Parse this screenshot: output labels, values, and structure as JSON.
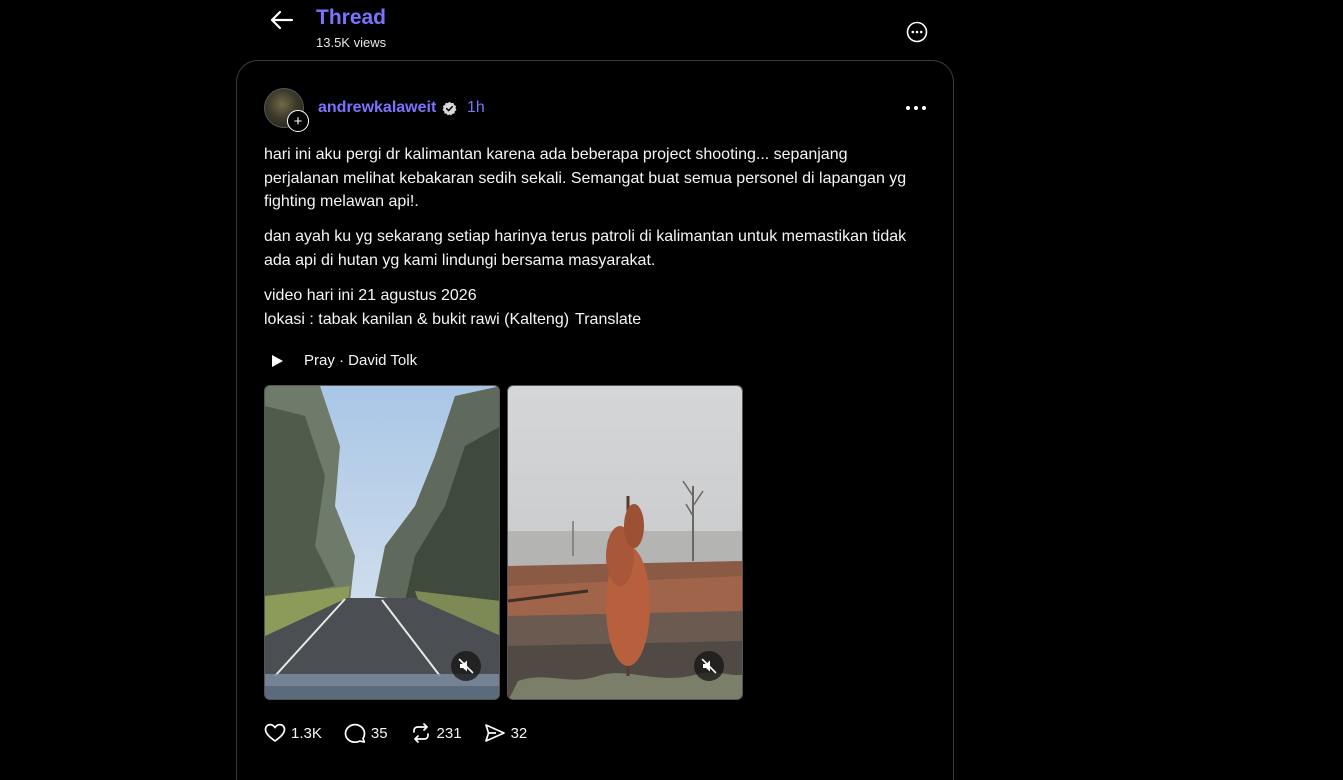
{
  "header": {
    "title": "Thread",
    "views": "13.5K views"
  },
  "post": {
    "username": "andrewkalaweit",
    "time": "1h",
    "paragraphs": [
      "hari ini aku pergi dr kalimantan karena ada beberapa project shooting... sepanjang perjalanan melihat kebakaran sedih sekali. Semangat buat semua personel di lapangan yg fighting melawan api!.",
      "dan ayah ku yg sekarang setiap harinya terus patroli di kalimantan untuk memastikan tidak ada api di hutan yg kami lindungi bersama masyarakat."
    ],
    "line_date": "video hari ini 21 agustus 2026",
    "line_location": "lokasi : tabak kanilan & bukit rawi (Kalteng)",
    "translate_label": "Translate",
    "music": "Pray · David Tolk",
    "counts": {
      "likes": "1.3K",
      "replies": "35",
      "reposts": "231",
      "shares": "32"
    }
  },
  "colors": {
    "accent": "#7b73ff",
    "background": "#000000",
    "text": "#f3f5f7"
  }
}
